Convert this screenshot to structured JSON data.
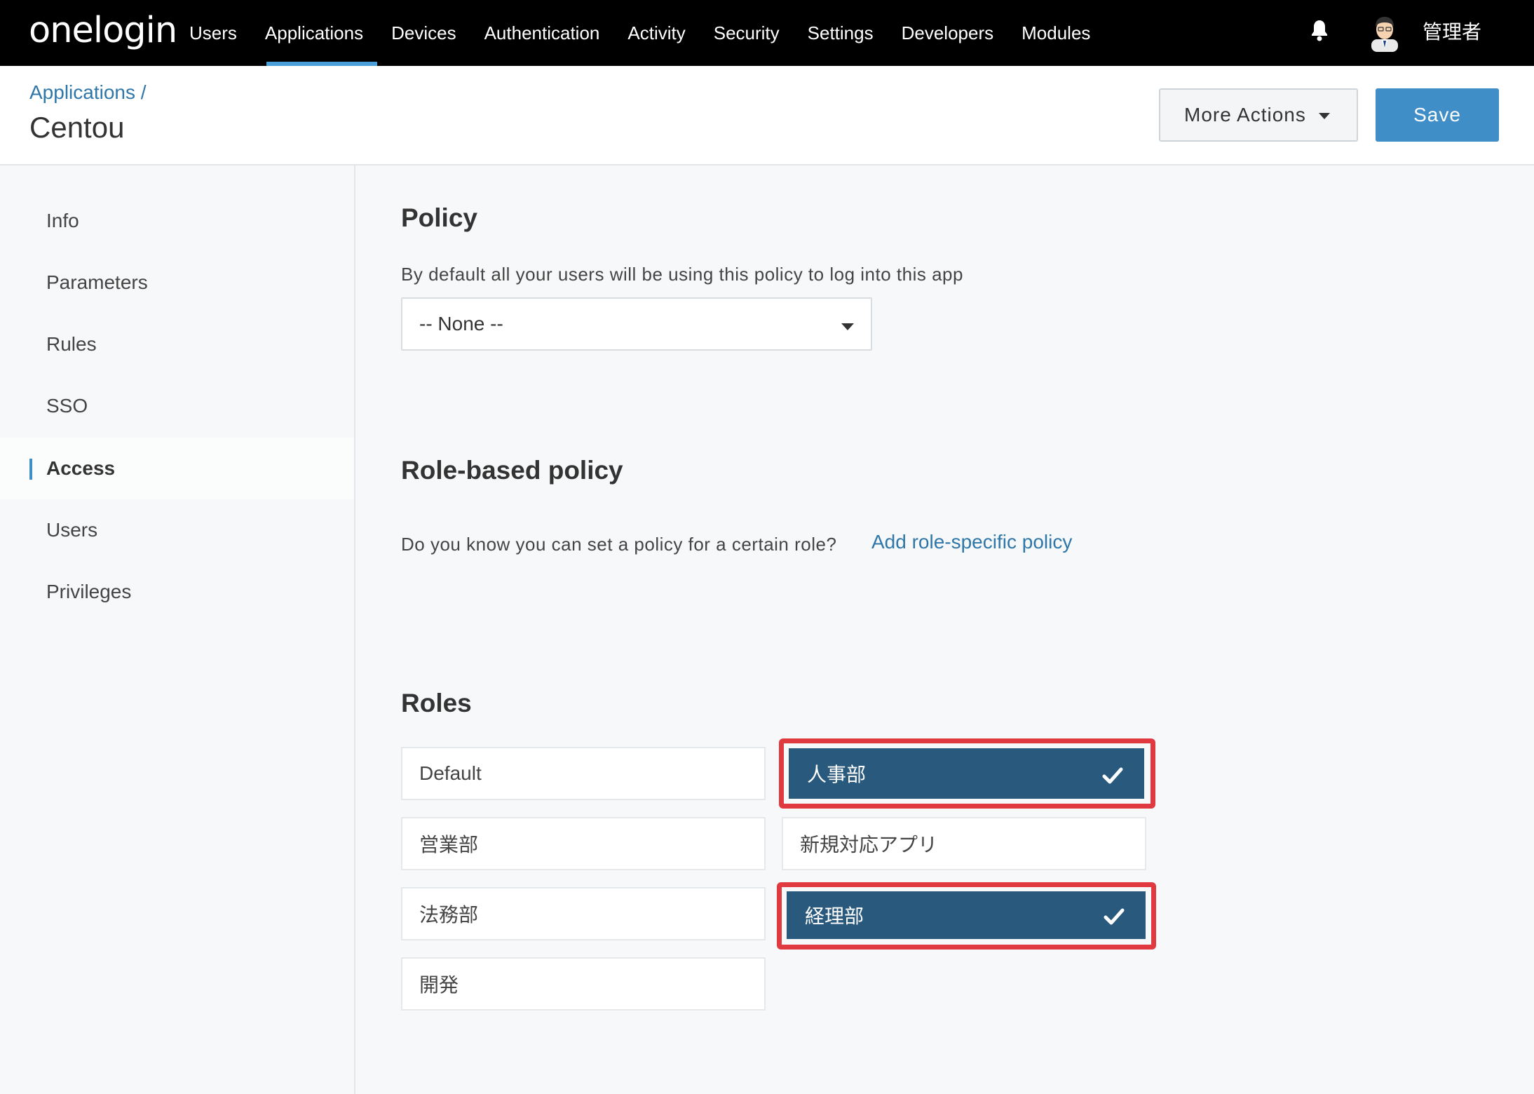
{
  "brand": {
    "logo": "onelogin"
  },
  "nav": {
    "items": [
      "Users",
      "Applications",
      "Devices",
      "Authentication",
      "Activity",
      "Security",
      "Settings",
      "Developers",
      "Modules"
    ],
    "active": "Applications",
    "user_name": "管理者",
    "accent": "#4a9fd8"
  },
  "header": {
    "breadcrumb": "Applications /",
    "title": "Centou",
    "more_actions_label": "More Actions",
    "save_label": "Save",
    "save_color": "#3f8ec8"
  },
  "sidebar": {
    "items": [
      "Info",
      "Parameters",
      "Rules",
      "SSO",
      "Access",
      "Users",
      "Privileges"
    ],
    "active": "Access"
  },
  "policy": {
    "heading": "Policy",
    "description": "By default all your users will be using this policy to log into this app",
    "selected": "-- None --"
  },
  "role_policy": {
    "heading": "Role-based policy",
    "question": "Do you know you can set a policy for a certain role?",
    "link": "Add role-specific policy"
  },
  "roles": {
    "heading": "Roles",
    "items": [
      {
        "label": "Default",
        "checked": false
      },
      {
        "label": "人事部",
        "checked": true
      },
      {
        "label": "営業部",
        "checked": false
      },
      {
        "label": "新規対応アプリ",
        "checked": false
      },
      {
        "label": "法務部",
        "checked": false
      },
      {
        "label": "経理部",
        "checked": true
      },
      {
        "label": "開発",
        "checked": false
      }
    ],
    "selected_color": "#295a7d",
    "highlight_color": "#e0393f"
  }
}
